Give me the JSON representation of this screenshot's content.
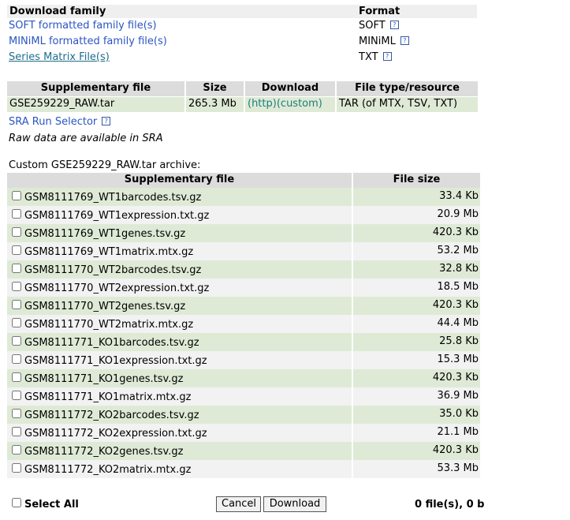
{
  "family": {
    "header": {
      "col1": "Download family",
      "col2": "Format"
    },
    "rows": [
      {
        "label": "SOFT formatted family file(s)",
        "format": "SOFT"
      },
      {
        "label": "MINiML formatted family file(s)",
        "format": "MINiML"
      },
      {
        "label": "Series Matrix File(s)",
        "format": "TXT"
      }
    ],
    "help_glyph": "?"
  },
  "supplementary": {
    "headers": [
      "Supplementary file",
      "Size",
      "Download",
      "File type/resource"
    ],
    "row": {
      "file": "GSE259229_RAW.tar",
      "size": "265.3 Mb",
      "http": "(http)",
      "custom": "(custom)",
      "type": "TAR (of MTX, TSV, TXT)"
    }
  },
  "sra_link": "SRA Run Selector",
  "raw_note": "Raw data are available in SRA",
  "custom_archive": {
    "title": "Custom GSE259229_RAW.tar archive:",
    "headers": [
      "Supplementary file",
      "File size"
    ],
    "files": [
      {
        "name": "GSM8111769_WT1barcodes.tsv.gz",
        "size": "33.4 Kb"
      },
      {
        "name": "GSM8111769_WT1expression.txt.gz",
        "size": "20.9 Mb"
      },
      {
        "name": "GSM8111769_WT1genes.tsv.gz",
        "size": "420.3 Kb"
      },
      {
        "name": "GSM8111769_WT1matrix.mtx.gz",
        "size": "53.2 Mb"
      },
      {
        "name": "GSM8111770_WT2barcodes.tsv.gz",
        "size": "32.8 Kb"
      },
      {
        "name": "GSM8111770_WT2expression.txt.gz",
        "size": "18.5 Mb"
      },
      {
        "name": "GSM8111770_WT2genes.tsv.gz",
        "size": "420.3 Kb"
      },
      {
        "name": "GSM8111770_WT2matrix.mtx.gz",
        "size": "44.4 Mb"
      },
      {
        "name": "GSM8111771_KO1barcodes.tsv.gz",
        "size": "25.8 Kb"
      },
      {
        "name": "GSM8111771_KO1expression.txt.gz",
        "size": "15.3 Mb"
      },
      {
        "name": "GSM8111771_KO1genes.tsv.gz",
        "size": "420.3 Kb"
      },
      {
        "name": "GSM8111771_KO1matrix.mtx.gz",
        "size": "36.9 Mb"
      },
      {
        "name": "GSM8111772_KO2barcodes.tsv.gz",
        "size": "35.0 Kb"
      },
      {
        "name": "GSM8111772_KO2expression.txt.gz",
        "size": "21.1 Mb"
      },
      {
        "name": "GSM8111772_KO2genes.tsv.gz",
        "size": "420.3 Kb"
      },
      {
        "name": "GSM8111772_KO2matrix.mtx.gz",
        "size": "53.3 Mb"
      }
    ]
  },
  "footer": {
    "select_all": "Select All",
    "cancel": "Cancel",
    "download": "Download",
    "count": "0 file(s), 0 b"
  },
  "colors": {
    "link": "#2b55c4",
    "custom_link": "#1a7f7a",
    "row_green": "#dfead6",
    "header_gray": "#dcdcdc"
  }
}
